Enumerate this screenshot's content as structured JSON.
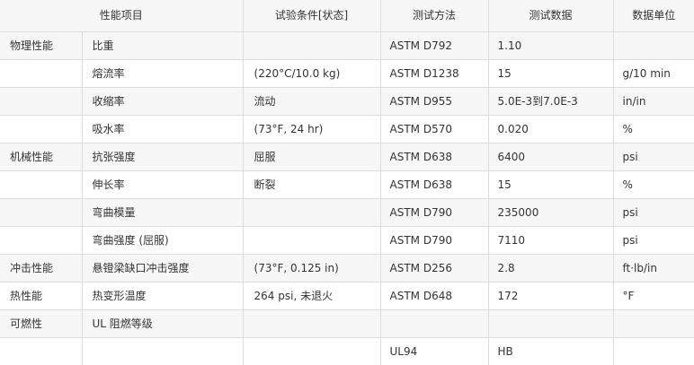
{
  "table": {
    "headers": [
      "性能项目",
      "试验条件[状态]",
      "测试方法",
      "测试数据",
      "数据单位"
    ],
    "rows": [
      {
        "category": "物理性能",
        "property": "比重",
        "condition": "",
        "method": "ASTM D792",
        "value": "1.10",
        "unit": ""
      },
      {
        "category": "",
        "property": "熔流率",
        "condition": "(220°C/10.0 kg)",
        "method": "ASTM D1238",
        "value": "15",
        "unit": "g/10 min"
      },
      {
        "category": "",
        "property": "收缩率",
        "condition": "流动",
        "method": "ASTM D955",
        "value": "5.0E-3到7.0E-3",
        "unit": "in/in"
      },
      {
        "category": "",
        "property": "吸水率",
        "condition": "(73°F, 24 hr)",
        "method": "ASTM D570",
        "value": "0.020",
        "unit": "%"
      },
      {
        "category": "机械性能",
        "property": "抗张强度",
        "condition": "屈服",
        "method": "ASTM D638",
        "value": "6400",
        "unit": "psi"
      },
      {
        "category": "",
        "property": "伸长率",
        "condition": "断裂",
        "method": "ASTM D638",
        "value": "15",
        "unit": "%"
      },
      {
        "category": "",
        "property": "弯曲模量",
        "condition": "",
        "method": "ASTM D790",
        "value": "235000",
        "unit": "psi"
      },
      {
        "category": "",
        "property": "弯曲强度 (屈服)",
        "condition": "",
        "method": "ASTM D790",
        "value": "7110",
        "unit": "psi"
      },
      {
        "category": "冲击性能",
        "property": "悬镫梁缺口冲击强度",
        "condition": "(73°F, 0.125 in)",
        "method": "ASTM D256",
        "value": "2.8",
        "unit": "ft·lb/in"
      },
      {
        "category": "热性能",
        "property": "热变形温度",
        "condition": "264 psi, 未退火",
        "method": "ASTM D648",
        "value": "172",
        "unit": "°F"
      },
      {
        "category": "可燃性",
        "property": "UL 阻燃等级",
        "condition": "",
        "method": "",
        "value": "",
        "unit": ""
      },
      {
        "category": "",
        "property": "",
        "condition": "",
        "method": "UL94",
        "value": "HB",
        "unit": ""
      }
    ]
  }
}
